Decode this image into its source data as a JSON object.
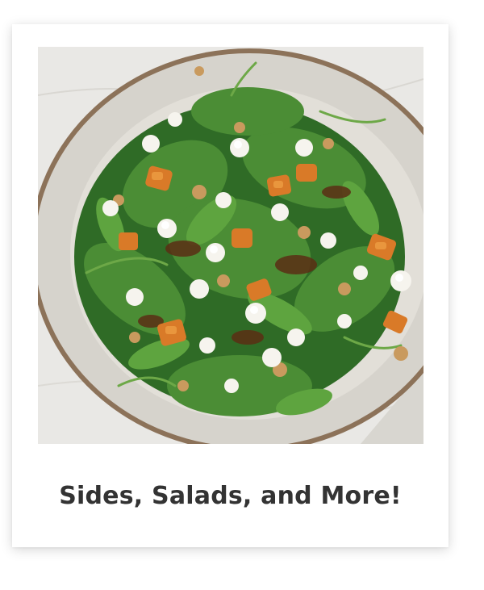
{
  "card": {
    "title": "Sides, Salads, and More!",
    "image_subject": "salad-plate-photo"
  },
  "colors": {
    "text": "#333333",
    "card_background": "#ffffff",
    "greens": "#3f7a2c",
    "squash": "#d9792a",
    "feta": "#f5f3ee",
    "plate": "#dcd9d2",
    "plate_rim": "#8a6e55"
  }
}
